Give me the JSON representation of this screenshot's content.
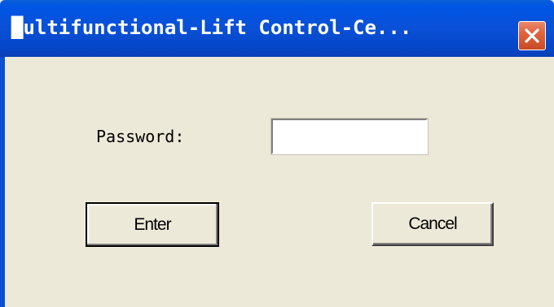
{
  "window": {
    "title": "█ultifunctional-Lift Control-Ce..."
  },
  "form": {
    "password_label": "Password:",
    "password_value": "",
    "password_placeholder": ""
  },
  "buttons": {
    "enter_label": "Enter",
    "cancel_label": "Cancel"
  },
  "icons": {
    "close": "close-icon"
  },
  "colors": {
    "titlebar": "#0a50d6",
    "dialog_background": "#ece9d8",
    "close_button": "#e0643e"
  }
}
